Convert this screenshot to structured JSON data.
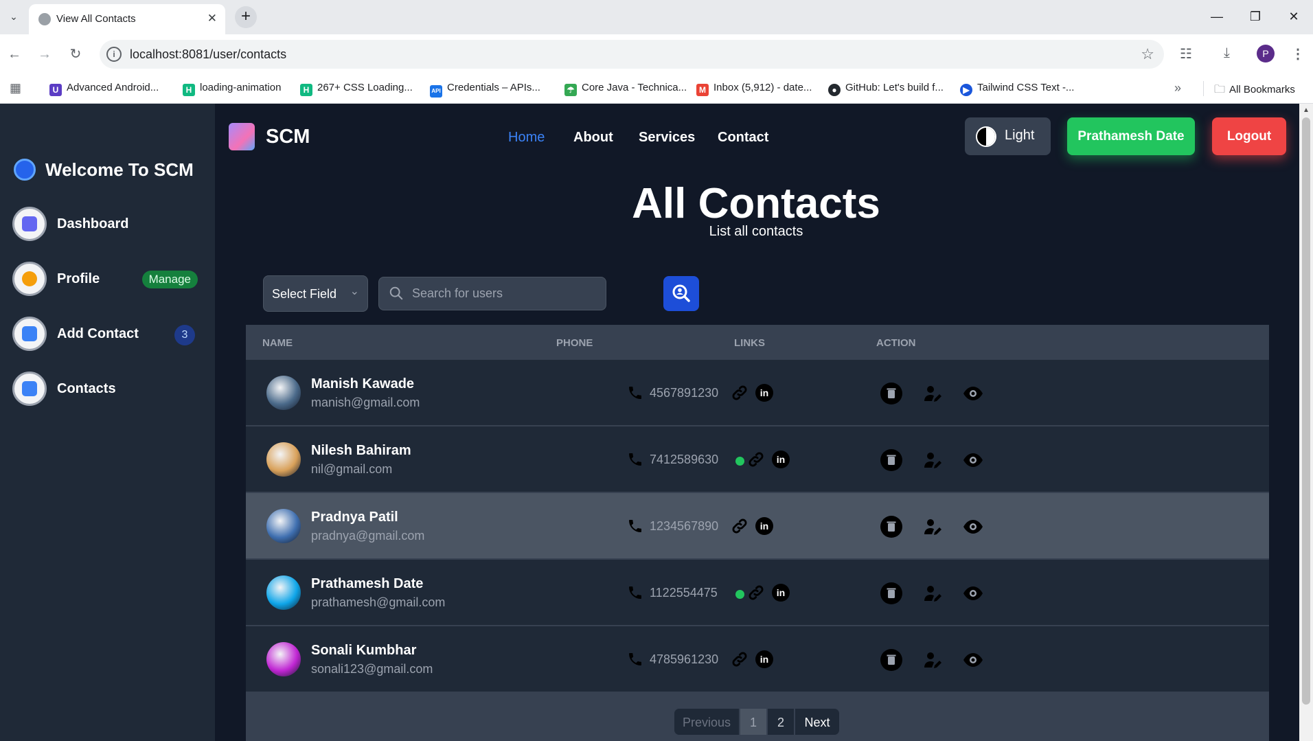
{
  "browser": {
    "tab_title": "View All Contacts",
    "url": "localhost:8081/user/contacts",
    "profile_initial": "P",
    "bookmarks": [
      {
        "label": "Advanced Android...",
        "icon": "u-icon",
        "color": "#5b3cc4"
      },
      {
        "label": "loading-animation",
        "icon": "h-icon",
        "color": "#10b981"
      },
      {
        "label": "267+ CSS Loading...",
        "icon": "h-icon",
        "color": "#10b981"
      },
      {
        "label": "Credentials – APIs...",
        "icon": "api-icon",
        "color": "#1a73e8"
      },
      {
        "label": "Core Java - Technica...",
        "icon": "umbrella-icon",
        "color": "#34a853"
      },
      {
        "label": "Inbox (5,912) - date...",
        "icon": "gmail-icon",
        "color": "#ea4335"
      },
      {
        "label": "GitHub: Let's build f...",
        "icon": "github-icon",
        "color": "#24292f"
      },
      {
        "label": "Tailwind CSS Text -...",
        "icon": "play-icon",
        "color": "#1a56db"
      }
    ],
    "all_bookmarks": "All Bookmarks"
  },
  "sidebar": {
    "brand": "Welcome To SCM",
    "items": [
      {
        "label": "Dashboard",
        "icon": "dashboard-icon",
        "color": "#6366f1"
      },
      {
        "label": "Profile",
        "icon": "profile-icon",
        "color": "#f59e0b",
        "badge": "Manage"
      },
      {
        "label": "Add Contact",
        "icon": "add-contact-icon",
        "color": "#3b82f6",
        "badge": "3"
      },
      {
        "label": "Contacts",
        "icon": "contacts-icon",
        "color": "#3b82f6"
      }
    ]
  },
  "navbar": {
    "brand": "SCM",
    "links": [
      "Home",
      "About",
      "Services",
      "Contact"
    ],
    "active_link": "Home",
    "theme_label": "Light",
    "user_label": "Prathamesh Date",
    "logout_label": "Logout"
  },
  "page": {
    "title": "All Contacts",
    "subtitle": "List all contacts"
  },
  "search": {
    "select_label": "Select Field",
    "placeholder": "Search for users"
  },
  "table": {
    "headers": [
      "NAME",
      "PHONE",
      "LINKS",
      "ACTION"
    ],
    "rows": [
      {
        "name": "Manish Kawade",
        "email": "manish@gmail.com",
        "phone": "4567891230",
        "favorite": false,
        "avatar_color": "#4b6a8a",
        "hover": false
      },
      {
        "name": "Nilesh Bahiram",
        "email": "nil@gmail.com",
        "phone": "7412589630",
        "favorite": true,
        "avatar_color": "#d9a15a",
        "hover": false
      },
      {
        "name": "Pradnya Patil",
        "email": "pradnya@gmail.com",
        "phone": "1234567890",
        "favorite": false,
        "avatar_color": "#3f6fb0",
        "hover": true
      },
      {
        "name": "Prathamesh Date",
        "email": "prathamesh@gmail.com",
        "phone": "1122554475",
        "favorite": true,
        "avatar_color": "#0ea5e9",
        "hover": false
      },
      {
        "name": "Sonali Kumbhar",
        "email": "sonali123@gmail.com",
        "phone": "4785961230",
        "favorite": false,
        "avatar_color": "#c026d3",
        "hover": false
      }
    ]
  },
  "pagination": {
    "previous": "Previous",
    "pages": [
      "1",
      "2"
    ],
    "current": "1",
    "next": "Next"
  }
}
